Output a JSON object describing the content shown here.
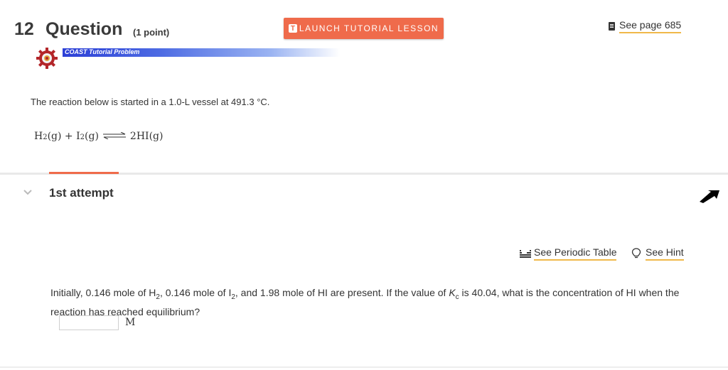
{
  "header": {
    "question_number": "12",
    "question_word": "Question",
    "points": "(1 point)",
    "launch_label": "LAUNCH TUTORIAL LESSON",
    "launch_icon_letter": "T",
    "see_page_label": "See page 685"
  },
  "banner": {
    "label": "COAST Tutorial Problem"
  },
  "problem": {
    "intro": "The reaction below is started in a 1.0-L vessel at 491.3 °C.",
    "equation": {
      "h": "H",
      "h_sub": "2",
      "g1": "(g)",
      "plus": " + ",
      "i": "I",
      "i_sub": "2",
      "g2": "(g)",
      "product": "2HI(g)"
    }
  },
  "attempt": {
    "label": "1st attempt"
  },
  "tools": {
    "periodic_label": "See Periodic Table",
    "hint_label": "See Hint"
  },
  "question": {
    "p1": "Initially, 0.146 mole of H",
    "p1_sub": "2",
    "p2": ", 0.146 mole of I",
    "p2_sub": "2",
    "p3": ", and 1.98 mole of HI are present. If the value of ",
    "k": "K",
    "k_sub": "c",
    "p4": " is 40.04, what is the concentration of HI when the reaction has reached equilibrium?",
    "answer_value": "",
    "unit": "M"
  },
  "colors": {
    "accent": "#ef6b4b",
    "underline": "#f0b84a",
    "banner_blue": "#2c3fd6"
  }
}
